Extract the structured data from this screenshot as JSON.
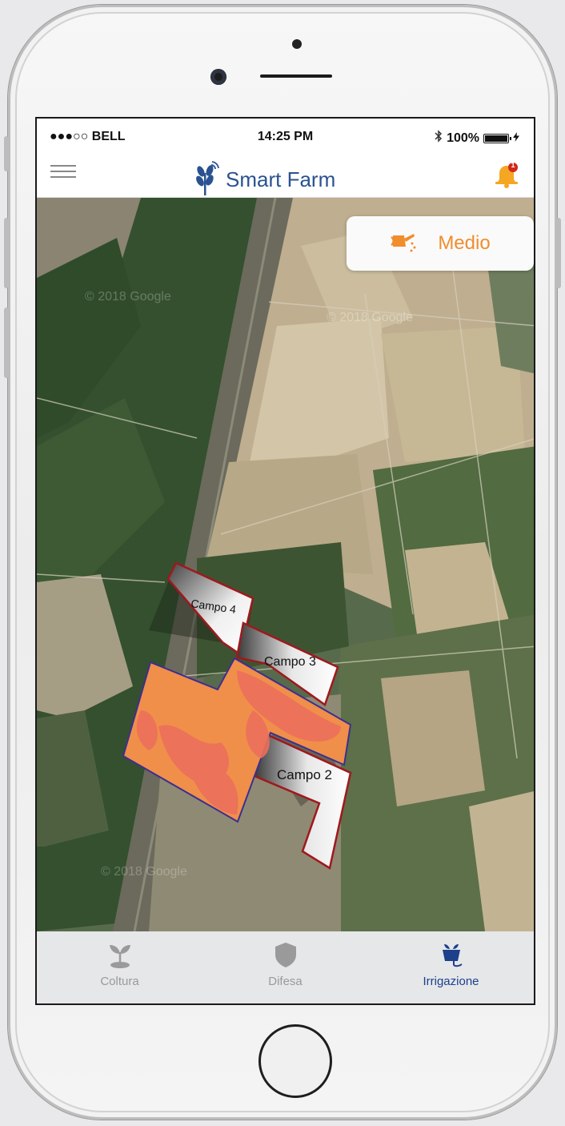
{
  "status_bar": {
    "carrier": "●●●○○ BELL",
    "time": "14:25 PM",
    "battery": "100%"
  },
  "header": {
    "title": "Smart Farm",
    "notification_count": "1",
    "brand_color": "#2a5291",
    "alert_color": "#f5a623"
  },
  "irrigation_card": {
    "icon": "watering-can-icon",
    "level": "Medio",
    "color": "#f08d2d"
  },
  "map": {
    "fields": [
      {
        "label": "Campo 4"
      },
      {
        "label": "Campo 3"
      },
      {
        "label": "Campo 2"
      }
    ],
    "watermark": "© 2018 Google"
  },
  "tabs": [
    {
      "label": "Coltura",
      "icon": "plant-icon",
      "active": false
    },
    {
      "label": "Difesa",
      "icon": "shield-icon",
      "active": false
    },
    {
      "label": "Irrigazione",
      "icon": "irrigation-icon",
      "active": true
    }
  ]
}
